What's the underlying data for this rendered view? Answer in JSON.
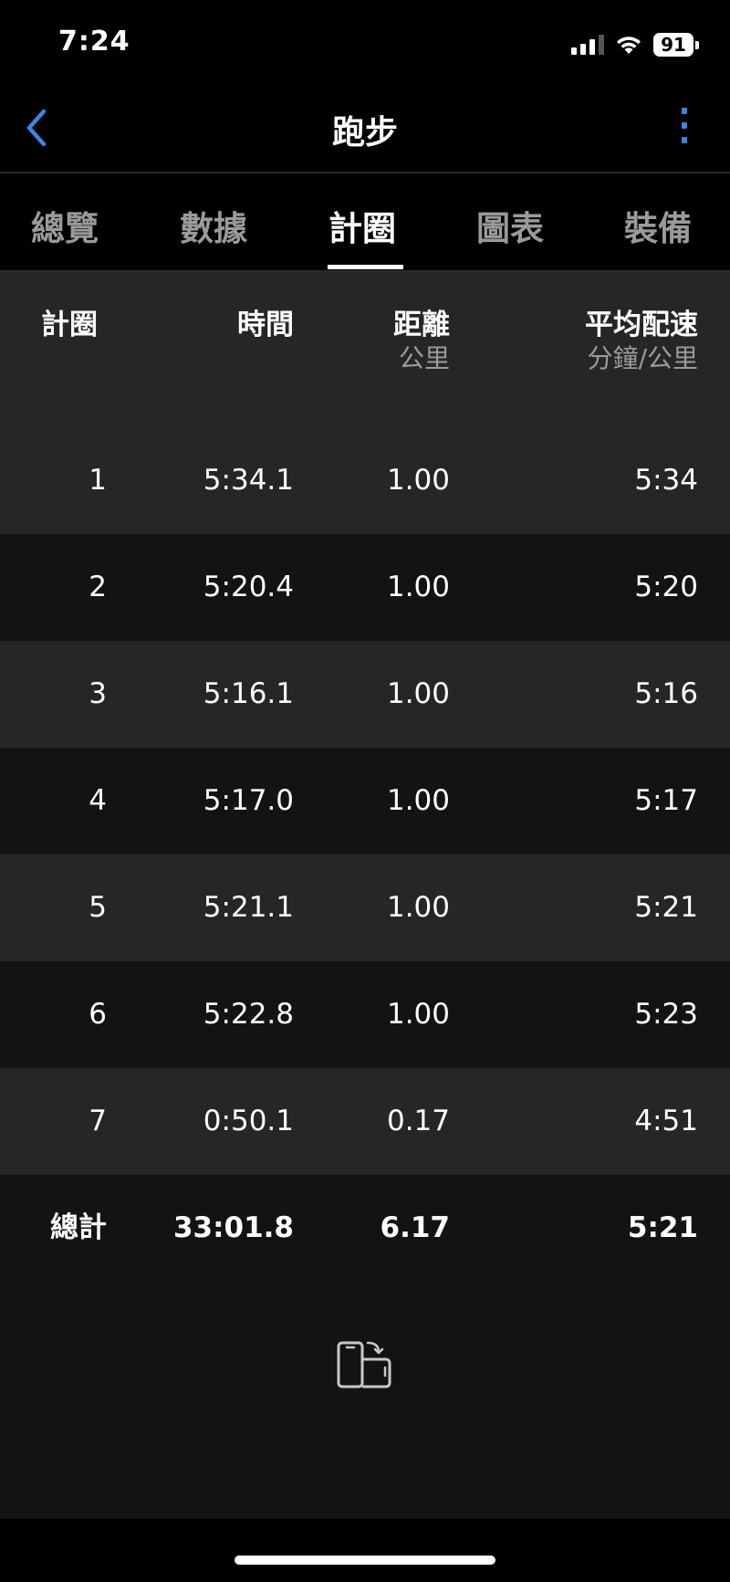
{
  "status": {
    "time": "7:24",
    "battery": "91"
  },
  "nav": {
    "title": "跑步",
    "back_icon": "chevron-left-icon",
    "more_icon": "more-vertical-icon",
    "accent_color": "#3b86e0"
  },
  "tabs": [
    {
      "label": "總覽",
      "active": false
    },
    {
      "label": "數據",
      "active": false
    },
    {
      "label": "計圈",
      "active": true
    },
    {
      "label": "圖表",
      "active": false
    },
    {
      "label": "裝備",
      "active": false
    }
  ],
  "table": {
    "headers": {
      "lap": "計圈",
      "time": "時間",
      "distance": "距離",
      "distance_unit": "公里",
      "pace": "平均配速",
      "pace_unit": "分鐘/公里"
    },
    "rows": [
      {
        "lap": "1",
        "time": "5:34.1",
        "distance": "1.00",
        "pace": "5:34"
      },
      {
        "lap": "2",
        "time": "5:20.4",
        "distance": "1.00",
        "pace": "5:20"
      },
      {
        "lap": "3",
        "time": "5:16.1",
        "distance": "1.00",
        "pace": "5:16"
      },
      {
        "lap": "4",
        "time": "5:17.0",
        "distance": "1.00",
        "pace": "5:17"
      },
      {
        "lap": "5",
        "time": "5:21.1",
        "distance": "1.00",
        "pace": "5:21"
      },
      {
        "lap": "6",
        "time": "5:22.8",
        "distance": "1.00",
        "pace": "5:23"
      },
      {
        "lap": "7",
        "time": "0:50.1",
        "distance": "0.17",
        "pace": "4:51"
      }
    ],
    "total": {
      "lap": "總計",
      "time": "33:01.8",
      "distance": "6.17",
      "pace": "5:21"
    }
  },
  "footer": {
    "rotate_icon": "rotate-device-icon"
  }
}
